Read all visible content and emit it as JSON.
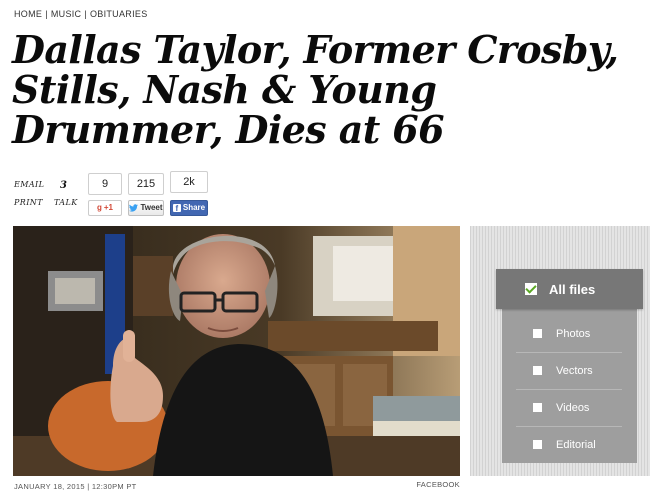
{
  "breadcrumb": {
    "home": "HOME",
    "sep1": "|",
    "music": "MUSIC",
    "sep2": "|",
    "obituaries": "OBITUARIES"
  },
  "headline": "Dallas Taylor, Former Crosby, Stills, Nash & Young Drummer, Dies at 66",
  "share": {
    "email_label": "EMAIL",
    "print_label": "PRINT",
    "talk_label": "TALK",
    "talk_count": "3",
    "gplus_count": "9",
    "gplus_label": "+1",
    "tweet_count": "215",
    "tweet_label": "Tweet",
    "fb_count": "2k",
    "fb_label": "Share"
  },
  "photo": {
    "date": "JANUARY 18, 2015 | 12:30PM PT",
    "credit": "FACEBOOK"
  },
  "filter": {
    "header_label": "All files",
    "header_checked": true,
    "options": [
      {
        "label": "Photos",
        "checked": false
      },
      {
        "label": "Vectors",
        "checked": false
      },
      {
        "label": "Videos",
        "checked": false
      },
      {
        "label": "Editorial",
        "checked": false
      }
    ]
  },
  "colors": {
    "facebook": "#4267b2",
    "gplus": "#d34836",
    "filter_header": "#777777",
    "filter_body": "#9e9e9e",
    "check_green": "#5ba825"
  }
}
